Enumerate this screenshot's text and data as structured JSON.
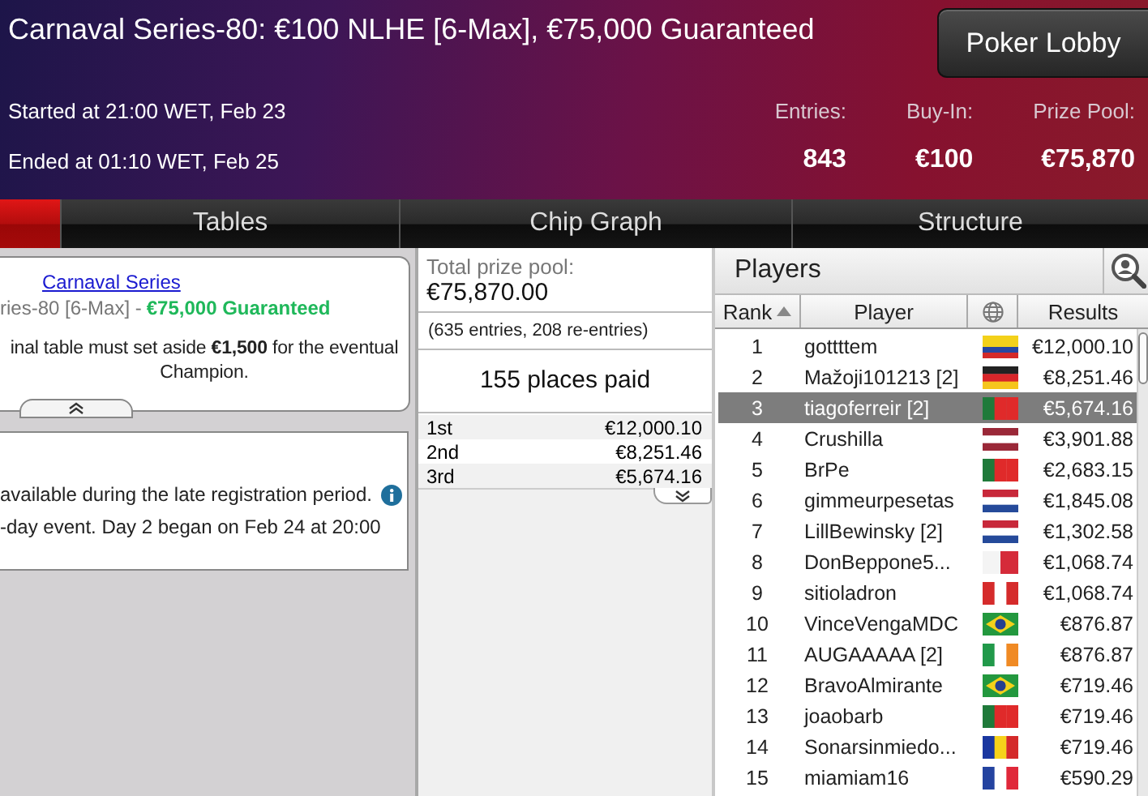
{
  "header": {
    "title": "Carnaval Series-80: €100 NLHE [6-Max], €75,000 Guaranteed",
    "lobby_button": "Poker Lobby",
    "started": "Started at 21:00 WET, Feb 23",
    "ended": "Ended at 01:10 WET, Feb 25",
    "stats": [
      {
        "label": "Entries:",
        "value": "843"
      },
      {
        "label": "Buy-In:",
        "value": "€100"
      },
      {
        "label": "Prize Pool:",
        "value": "€75,870"
      }
    ]
  },
  "tabs": [
    {
      "selected": true
    },
    {
      "label": "Tables",
      "selected": false
    },
    {
      "label": "Chip Graph",
      "selected": false
    },
    {
      "label": "Structure",
      "selected": false
    }
  ],
  "info_card": {
    "link": "Carnaval Series",
    "subtitle": "ries-80 [6-Max] -",
    "guarantee": "€75,000 Guaranteed",
    "note": "inal table must set aside **€1,500** for the eventual Champion."
  },
  "details_card": {
    "lines": [
      "available during the late registration period.",
      "-day event. Day 2 began on Feb 24 at 20:00"
    ]
  },
  "prizes": {
    "label": "Total prize pool:",
    "total": "€75,870.00",
    "entries": "(635 entries, 208 re-entries)",
    "places_paid": "155 places paid",
    "rows": [
      {
        "place": "1st",
        "amount": "€12,000.10"
      },
      {
        "place": "2nd",
        "amount": "€8,251.46"
      },
      {
        "place": "3rd",
        "amount": "€5,674.16"
      }
    ]
  },
  "players": {
    "title": "Players",
    "columns": [
      "Rank",
      "Player",
      "Results"
    ],
    "rows": [
      {
        "rank": "1",
        "name": "gottttem",
        "result": "€12,000.10",
        "selected": false,
        "kind": "ecuador"
      },
      {
        "rank": "2",
        "name": "Mažoji101213 [2]",
        "result": "€8,251.46",
        "selected": false,
        "kind": "germany"
      },
      {
        "rank": "3",
        "name": "tiagoferreir [2]",
        "result": "€5,674.16",
        "selected": true,
        "kind": "portugal"
      },
      {
        "rank": "4",
        "name": "Crushilla",
        "result": "€3,901.88",
        "selected": false,
        "kind": "latvia"
      },
      {
        "rank": "5",
        "name": "BrPe",
        "result": "€2,683.15",
        "selected": false,
        "kind": "portugal"
      },
      {
        "rank": "6",
        "name": "gimmeurpesetas",
        "result": "€1,845.08",
        "selected": false,
        "kind": "netherlands"
      },
      {
        "rank": "7",
        "name": "LillBewinsky [2]",
        "result": "€1,302.58",
        "selected": false,
        "kind": "netherlands"
      },
      {
        "rank": "8",
        "name": "DonBeppone5...",
        "result": "€1,068.74",
        "selected": false,
        "kind": "malta"
      },
      {
        "rank": "9",
        "name": "sitioladron",
        "result": "€1,068.74",
        "selected": false,
        "kind": "peru"
      },
      {
        "rank": "10",
        "name": "VinceVengaMDC",
        "result": "€876.87",
        "selected": false,
        "kind": "brazil"
      },
      {
        "rank": "11",
        "name": "AUGAAAAA [2]",
        "result": "€876.87",
        "selected": false,
        "kind": "ireland"
      },
      {
        "rank": "12",
        "name": "BravoAlmirante",
        "result": "€719.46",
        "selected": false,
        "kind": "brazil"
      },
      {
        "rank": "13",
        "name": "joaobarb",
        "result": "€719.46",
        "selected": false,
        "kind": "portugal"
      },
      {
        "rank": "14",
        "name": "Sonarsinmiedo...",
        "result": "€719.46",
        "selected": false,
        "kind": "andorra"
      },
      {
        "rank": "15",
        "name": "miamiam16",
        "result": "€590.29",
        "selected": false,
        "kind": "france"
      }
    ]
  }
}
